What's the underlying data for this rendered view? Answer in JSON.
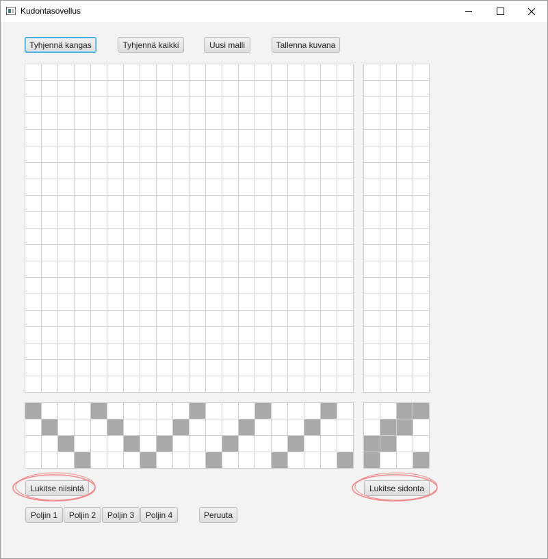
{
  "window": {
    "title": "Kudontasovellus",
    "icon": "app-icon",
    "controls": [
      "minimize-icon",
      "maximize-icon",
      "close-icon"
    ]
  },
  "toolbar": {
    "clear_fabric": "Tyhjennä kangas",
    "clear_all": "Tyhjennä kaikki",
    "new_pattern": "Uusi malli",
    "save_image": "Tallenna kuvana"
  },
  "lock_buttons": {
    "lock_threading": "Lukitse niisintä",
    "lock_tieup": "Lukitse sidonta"
  },
  "bottom_buttons": {
    "pedal_1": "Poljin 1",
    "pedal_2": "Poljin 2",
    "pedal_3": "Poljin 3",
    "pedal_4": "Poljin 4",
    "cancel": "Peruuta"
  },
  "colors": {
    "filled_cell": "#a9a9a9",
    "empty_cell": "#ffffff",
    "grid_line": "#d0d0d0",
    "focus_border": "#2a9fd8",
    "annotation": "#f08a8a"
  },
  "grids": {
    "fabric": {
      "rows": 20,
      "cols": 20,
      "filled": []
    },
    "treadling": {
      "rows": 20,
      "cols": 4,
      "filled": []
    },
    "threading": {
      "rows": 4,
      "cols": 20,
      "filled": [
        [
          0,
          0
        ],
        [
          0,
          4
        ],
        [
          0,
          10
        ],
        [
          0,
          14
        ],
        [
          0,
          18
        ],
        [
          1,
          1
        ],
        [
          1,
          5
        ],
        [
          1,
          9
        ],
        [
          1,
          13
        ],
        [
          1,
          17
        ],
        [
          2,
          2
        ],
        [
          2,
          6
        ],
        [
          2,
          8
        ],
        [
          2,
          12
        ],
        [
          2,
          16
        ],
        [
          3,
          3
        ],
        [
          3,
          7
        ],
        [
          3,
          11
        ],
        [
          3,
          15
        ],
        [
          3,
          19
        ]
      ]
    },
    "tieup": {
      "rows": 4,
      "cols": 4,
      "filled": [
        [
          0,
          2
        ],
        [
          0,
          3
        ],
        [
          1,
          1
        ],
        [
          1,
          2
        ],
        [
          2,
          0
        ],
        [
          2,
          1
        ],
        [
          3,
          0
        ],
        [
          3,
          3
        ]
      ]
    }
  }
}
